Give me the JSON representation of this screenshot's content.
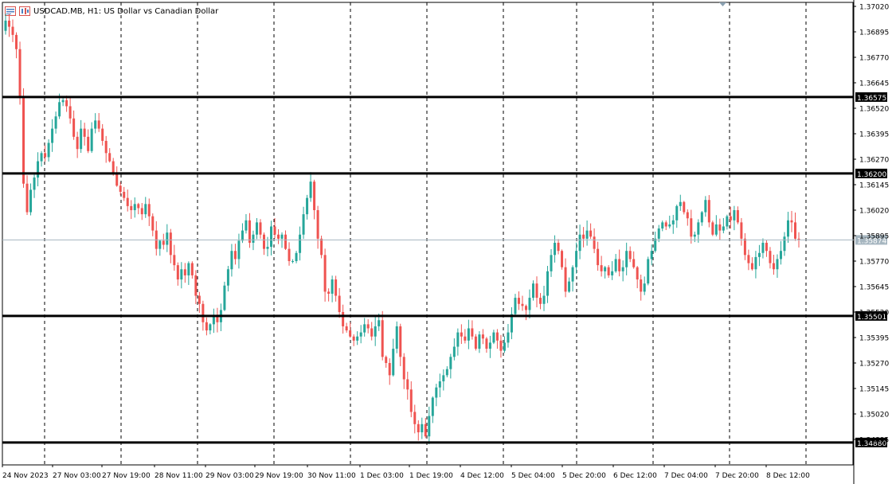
{
  "window": {
    "title": "USDCAD.MB, H1:  US Dollar vs Canadian Dollar"
  },
  "colors": {
    "bull": "#26a69a",
    "bear": "#ef5350",
    "grid": "#000000",
    "level_line": "#000000",
    "bid_line": "#a6b6c0"
  },
  "chart_data": {
    "type": "candlestick",
    "symbol": "USDCAD.MB",
    "timeframe": "H1",
    "y_ticks": [
      "1.37020",
      "1.36895",
      "1.36770",
      "1.36645",
      "1.36520",
      "1.36395",
      "1.36270",
      "1.36145",
      "1.36020",
      "1.35895",
      "1.35770",
      "1.35645",
      "1.35520",
      "1.35395",
      "1.35270",
      "1.35145",
      "1.35020",
      "1.34895"
    ],
    "x_ticks": [
      "24 Nov 2023",
      "27 Nov 03:00",
      "27 Nov 19:00",
      "28 Nov 11:00",
      "29 Nov 03:00",
      "29 Nov 19:00",
      "30 Nov 11:00",
      "1 Dec 03:00",
      "1 Dec 19:00",
      "4 Dec 12:00",
      "5 Dec 04:00",
      "5 Dec 20:00",
      "6 Dec 12:00",
      "7 Dec 04:00",
      "7 Dec 20:00",
      "8 Dec 12:00"
    ],
    "levels": [
      {
        "price": 1.36575,
        "label": "1.36575"
      },
      {
        "price": 1.362,
        "label": "1.36200"
      },
      {
        "price": 1.35501,
        "label": "1.35501"
      },
      {
        "price": 1.3488,
        "label": "1.34880"
      }
    ],
    "bid": {
      "price": 1.35874,
      "label": "1.35874"
    },
    "ylim": [
      1.3483,
      1.3702
    ],
    "close_path": [
      1.3695,
      1.3692,
      1.3688,
      1.3681,
      1.3658,
      1.3615,
      1.3601,
      1.3612,
      1.3618,
      1.3626,
      1.363,
      1.3628,
      1.3635,
      1.3642,
      1.3648,
      1.3655,
      1.3656,
      1.3653,
      1.3647,
      1.3638,
      1.3632,
      1.3642,
      1.3638,
      1.3631,
      1.3642,
      1.3646,
      1.3642,
      1.3636,
      1.363,
      1.3626,
      1.362,
      1.3614,
      1.3611,
      1.3608,
      1.3604,
      1.3602,
      1.3605,
      1.3603,
      1.36,
      1.3605,
      1.3599,
      1.3592,
      1.3583,
      1.3587,
      1.3585,
      1.3591,
      1.358,
      1.3575,
      1.3568,
      1.3573,
      1.357,
      1.3576,
      1.357,
      1.356,
      1.3556,
      1.3547,
      1.3543,
      1.3546,
      1.355,
      1.3547,
      1.3553,
      1.3565,
      1.3573,
      1.3582,
      1.3578,
      1.3587,
      1.3592,
      1.3597,
      1.3586,
      1.359,
      1.3596,
      1.359,
      1.3583,
      1.3584,
      1.3594,
      1.359,
      1.3588,
      1.359,
      1.3583,
      1.3577,
      1.3577,
      1.3581,
      1.359,
      1.36,
      1.3608,
      1.3616,
      1.3602,
      1.3588,
      1.358,
      1.3562,
      1.3561,
      1.3568,
      1.356,
      1.3552,
      1.3545,
      1.3543,
      1.354,
      1.3538,
      1.354,
      1.3542,
      1.3546,
      1.3544,
      1.354,
      1.3545,
      1.3548,
      1.353,
      1.3527,
      1.3521,
      1.3534,
      1.3545,
      1.353,
      1.3519,
      1.3514,
      1.3503,
      1.3497,
      1.3493,
      1.3497,
      1.3491,
      1.3501,
      1.351,
      1.3515,
      1.3518,
      1.3521,
      1.3524,
      1.353,
      1.3535,
      1.3542,
      1.354,
      1.3538,
      1.3544,
      1.354,
      1.3534,
      1.3541,
      1.3539,
      1.3534,
      1.3537,
      1.3542,
      1.3538,
      1.3533,
      1.3537,
      1.3542,
      1.3551,
      1.3559,
      1.3556,
      1.3555,
      1.3553,
      1.3559,
      1.3566,
      1.3559,
      1.3556,
      1.356,
      1.3572,
      1.358,
      1.3586,
      1.3582,
      1.3574,
      1.3562,
      1.3567,
      1.3574,
      1.3582,
      1.359,
      1.3588,
      1.3592,
      1.3589,
      1.3583,
      1.3575,
      1.3572,
      1.3574,
      1.357,
      1.3572,
      1.3578,
      1.3572,
      1.3574,
      1.3582,
      1.3578,
      1.3574,
      1.3568,
      1.3562,
      1.3566,
      1.3578,
      1.3582,
      1.3588,
      1.3593,
      1.3596,
      1.3594,
      1.3595,
      1.3597,
      1.3604,
      1.3606,
      1.3601,
      1.3598,
      1.3589,
      1.359,
      1.3596,
      1.3601,
      1.3607,
      1.3596,
      1.359,
      1.3595,
      1.3592,
      1.3594,
      1.3599,
      1.3597,
      1.3602,
      1.3596,
      1.3588,
      1.358,
      1.3576,
      1.3573,
      1.3579,
      1.3581,
      1.3586,
      1.3582,
      1.3576,
      1.3573,
      1.3578,
      1.3582,
      1.3589,
      1.3597,
      1.3596,
      1.3588,
      1.35874
    ]
  }
}
